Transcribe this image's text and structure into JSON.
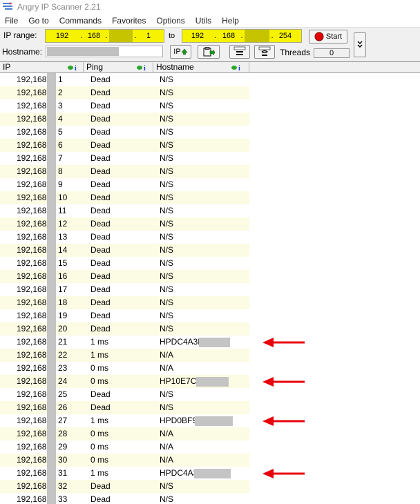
{
  "window": {
    "title": "Angry IP Scanner 2.21"
  },
  "menu": [
    "File",
    "Go to",
    "Commands",
    "Favorites",
    "Options",
    "Utils",
    "Help"
  ],
  "toolbar": {
    "ip_range_label": "IP range:",
    "from": {
      "o1": "192",
      "o2": "168",
      "o4": "1"
    },
    "to_label": "to",
    "to": {
      "o1": "192",
      "o2": "168",
      "o4": "254"
    },
    "start_label": "Start",
    "hostname_label": "Hostname:",
    "ip_button_label": "IP",
    "threads_label": "Threads",
    "threads_value": "0"
  },
  "columns": {
    "ip": "IP",
    "ping": "Ping",
    "hostname": "Hostname"
  },
  "rows": [
    {
      "ip": "192,168,",
      "last": "1",
      "ping": "Dead",
      "host": "N/S",
      "status": "dead"
    },
    {
      "ip": "192,168,",
      "last": "2",
      "ping": "Dead",
      "host": "N/S",
      "status": "dead"
    },
    {
      "ip": "192,168,",
      "last": "3",
      "ping": "Dead",
      "host": "N/S",
      "status": "dead"
    },
    {
      "ip": "192,168,",
      "last": "4",
      "ping": "Dead",
      "host": "N/S",
      "status": "dead"
    },
    {
      "ip": "192,168,",
      "last": "5",
      "ping": "Dead",
      "host": "N/S",
      "status": "dead"
    },
    {
      "ip": "192,168,",
      "last": "6",
      "ping": "Dead",
      "host": "N/S",
      "status": "dead"
    },
    {
      "ip": "192,168,",
      "last": "7",
      "ping": "Dead",
      "host": "N/S",
      "status": "dead"
    },
    {
      "ip": "192,168,",
      "last": "8",
      "ping": "Dead",
      "host": "N/S",
      "status": "dead"
    },
    {
      "ip": "192,168,",
      "last": "9",
      "ping": "Dead",
      "host": "N/S",
      "status": "dead"
    },
    {
      "ip": "192,168,",
      "last": "10",
      "ping": "Dead",
      "host": "N/S",
      "status": "dead"
    },
    {
      "ip": "192,168,",
      "last": "11",
      "ping": "Dead",
      "host": "N/S",
      "status": "dead"
    },
    {
      "ip": "192,168,",
      "last": "12",
      "ping": "Dead",
      "host": "N/S",
      "status": "dead"
    },
    {
      "ip": "192,168,",
      "last": "13",
      "ping": "Dead",
      "host": "N/S",
      "status": "dead"
    },
    {
      "ip": "192,168,",
      "last": "14",
      "ping": "Dead",
      "host": "N/S",
      "status": "dead"
    },
    {
      "ip": "192,168,",
      "last": "15",
      "ping": "Dead",
      "host": "N/S",
      "status": "dead"
    },
    {
      "ip": "192,168,",
      "last": "16",
      "ping": "Dead",
      "host": "N/S",
      "status": "dead"
    },
    {
      "ip": "192,168,",
      "last": "17",
      "ping": "Dead",
      "host": "N/S",
      "status": "dead"
    },
    {
      "ip": "192,168,",
      "last": "18",
      "ping": "Dead",
      "host": "N/S",
      "status": "dead"
    },
    {
      "ip": "192,168,",
      "last": "19",
      "ping": "Dead",
      "host": "N/S",
      "status": "dead"
    },
    {
      "ip": "192,168,",
      "last": "20",
      "ping": "Dead",
      "host": "N/S",
      "status": "dead"
    },
    {
      "ip": "192,168,",
      "last": "21",
      "ping": "1 ms",
      "host": "HPDC4A3E",
      "status": "alive",
      "arrow": true
    },
    {
      "ip": "192,168,",
      "last": "22",
      "ping": "1 ms",
      "host": "N/A",
      "status": "alive"
    },
    {
      "ip": "192,168,",
      "last": "23",
      "ping": "0 ms",
      "host": "N/A",
      "status": "alive"
    },
    {
      "ip": "192,168,",
      "last": "24",
      "ping": "0 ms",
      "host": "HP10E7C6",
      "status": "alive",
      "arrow": true
    },
    {
      "ip": "192,168,",
      "last": "25",
      "ping": "Dead",
      "host": "N/S",
      "status": "dead"
    },
    {
      "ip": "192,168,",
      "last": "26",
      "ping": "Dead",
      "host": "N/S",
      "status": "dead"
    },
    {
      "ip": "192,168,",
      "last": "27",
      "ping": "1 ms",
      "host": "HPD0BF9",
      "status": "alive",
      "arrow": true
    },
    {
      "ip": "192,168,",
      "last": "28",
      "ping": "0 ms",
      "host": "N/A",
      "status": "alive"
    },
    {
      "ip": "192,168,",
      "last": "29",
      "ping": "0 ms",
      "host": "N/A",
      "status": "alive"
    },
    {
      "ip": "192,168,",
      "last": "30",
      "ping": "0 ms",
      "host": "N/A",
      "status": "alive"
    },
    {
      "ip": "192,168,",
      "last": "31",
      "ping": "1 ms",
      "host": "HPDC4A3",
      "status": "alive",
      "arrow": true
    },
    {
      "ip": "192,168,",
      "last": "32",
      "ping": "Dead",
      "host": "N/S",
      "status": "dead"
    },
    {
      "ip": "192,168,",
      "last": "33",
      "ping": "Dead",
      "host": "N/S",
      "status": "dead"
    }
  ],
  "colors": {
    "highlight": "#f6f200",
    "dead": "#e00000",
    "alive": "#0a14d8",
    "arrow": "#e8000b",
    "row_alt": "#fcfbe3"
  }
}
